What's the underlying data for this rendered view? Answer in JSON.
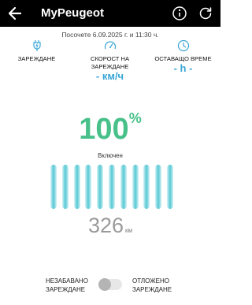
{
  "header": {
    "title": "MyPeugeot",
    "back_icon": "arrow-left-icon",
    "info_icon": "info-circle-icon",
    "refresh_icon": "refresh-icon"
  },
  "last_visited": "Посочете 6.09.2025 г. и 11:30 ч.",
  "cards": [
    {
      "label": "ЗАРЕЖДАНЕ",
      "value": "",
      "icon": "plug-icon"
    },
    {
      "label": "СКОРОСТ НА ЗАРЕЖДАНЕ",
      "value": "- км/ч",
      "icon": "speedometer-icon"
    },
    {
      "label": "ОСТАВАЩО ВРЕМЕ",
      "value": "- h -",
      "icon": "clock-icon"
    }
  ],
  "battery": {
    "percent": "100",
    "percent_sign": "%",
    "status": "Включен",
    "level": 1.0
  },
  "range": {
    "value": "326",
    "unit": "км"
  },
  "charge_mode": {
    "left_label_1": "НЕЗАБАВАНО",
    "left_label_2": "ЗАРЕЖДАНЕ",
    "right_label_1": "ОТЛОЖЕНО",
    "right_label_2": "ЗАРЕЖДАНЕ",
    "deferred_enabled": false
  },
  "colors": {
    "accent_green": "#48c08a",
    "accent_blue": "#3aa6d6",
    "battery_cyan": "#61cbd6"
  }
}
